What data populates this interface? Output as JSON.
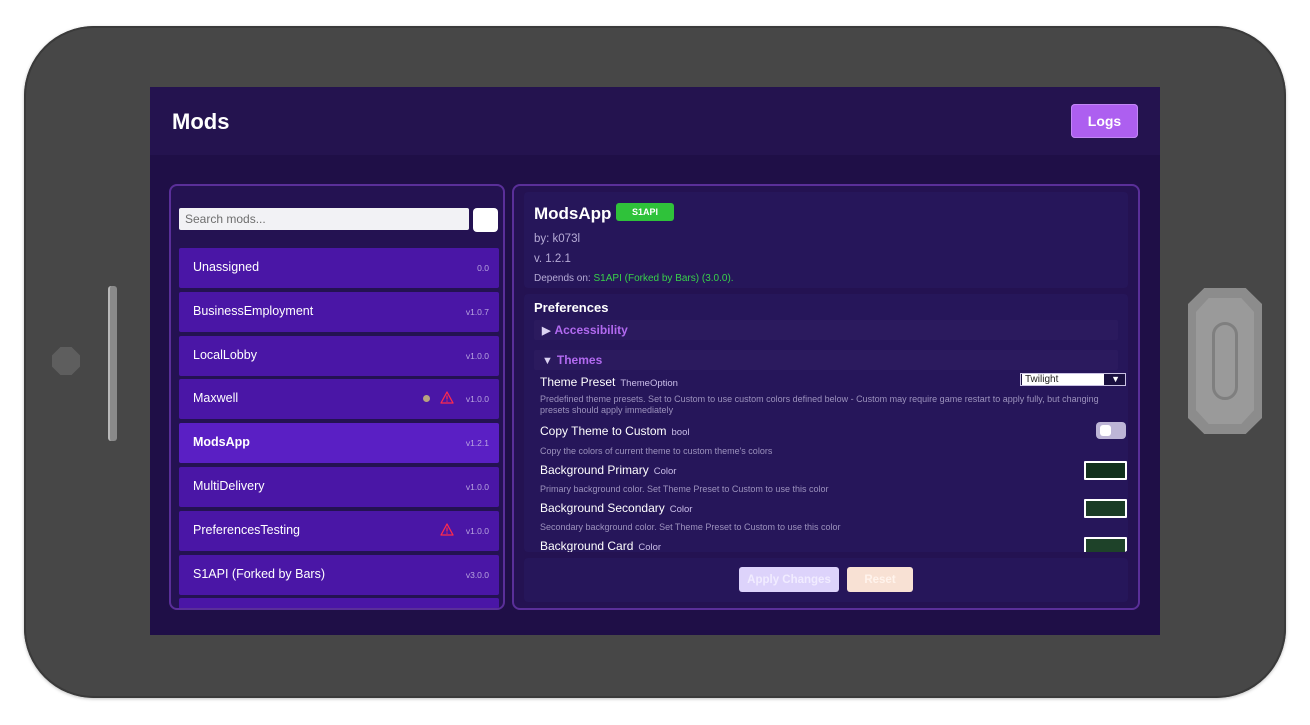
{
  "header": {
    "title": "Mods",
    "logs_label": "Logs"
  },
  "search": {
    "placeholder": "Search mods...",
    "value": ""
  },
  "mods": [
    {
      "name": "Unassigned",
      "version": "0.0",
      "status_dot": false,
      "warning": false
    },
    {
      "name": "BusinessEmployment",
      "version": "v1.0.7",
      "status_dot": false,
      "warning": false
    },
    {
      "name": "LocalLobby",
      "version": "v1.0.0",
      "status_dot": false,
      "warning": false
    },
    {
      "name": "Maxwell",
      "version": "v1.0.0",
      "status_dot": true,
      "warning": true
    },
    {
      "name": "ModsApp",
      "version": "v1.2.1",
      "status_dot": false,
      "warning": false,
      "selected": true
    },
    {
      "name": "MultiDelivery",
      "version": "v1.0.0",
      "status_dot": false,
      "warning": false
    },
    {
      "name": "PreferencesTesting",
      "version": "v1.0.0",
      "status_dot": false,
      "warning": true
    },
    {
      "name": "S1API (Forked by Bars)",
      "version": "v3.0.0",
      "status_dot": false,
      "warning": false
    }
  ],
  "detail": {
    "name": "ModsApp",
    "tag": "S1API",
    "author": "by: k073l",
    "version": "v. 1.2.1",
    "depends_label": "Depends on:",
    "depends_value": "S1API (Forked by Bars) (3.0.0)."
  },
  "preferences": {
    "title": "Preferences",
    "sections": [
      {
        "label": "Accessibility",
        "expanded": false,
        "arrow": "▶"
      },
      {
        "label": "Themes",
        "expanded": true,
        "arrow": "▼"
      }
    ],
    "items": [
      {
        "name": "Theme Preset",
        "type": "ThemeOption",
        "description": "Predefined theme presets. Set to Custom to use custom colors defined below - Custom may require game restart to apply fully, but changing presets should apply immediately",
        "control": "select",
        "value": "Twilight",
        "arrow": "▼"
      },
      {
        "name": "Copy Theme to Custom",
        "type": "bool",
        "description": "Copy the colors of current theme to custom theme's colors",
        "control": "toggle",
        "value": false
      },
      {
        "name": "Background Primary",
        "type": "Color",
        "description": "Primary background color. Set Theme Preset to Custom to use this color",
        "control": "color",
        "color": "#12301d"
      },
      {
        "name": "Background Secondary",
        "type": "Color",
        "description": "Secondary background color. Set Theme Preset to Custom to use this color",
        "control": "color",
        "color": "#1a3b25"
      },
      {
        "name": "Background Card",
        "type": "Color",
        "description": "",
        "control": "color",
        "color": "#1e4229"
      }
    ]
  },
  "actions": {
    "apply_label": "Apply Changes",
    "reset_label": "Reset"
  },
  "colors": {
    "accent": "#ad5ff0",
    "list_item": "#4a16a6",
    "selected": "#5a1fc4",
    "tag": "#2fc23a",
    "screen_bg": "#1f0f47"
  },
  "icons": {
    "warning": "warning-triangle-icon",
    "expand": "triangle-right-icon",
    "collapse": "triangle-down-icon"
  }
}
